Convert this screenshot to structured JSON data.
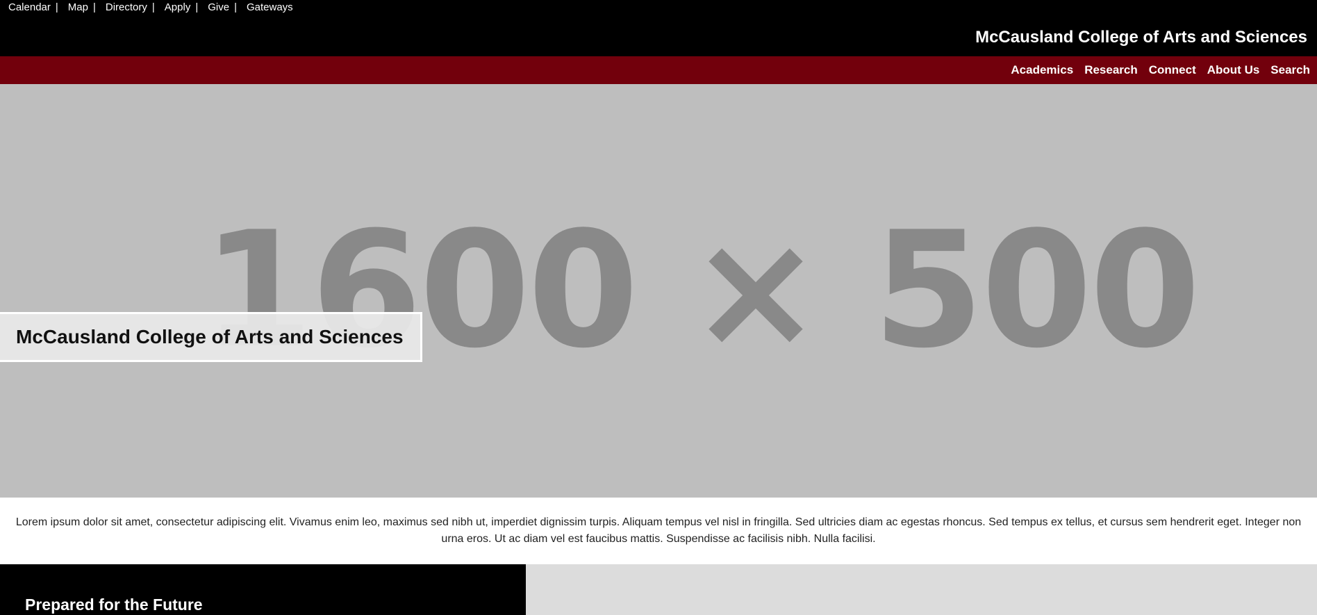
{
  "utility_nav": {
    "items": [
      {
        "label": "Calendar",
        "sep": "|"
      },
      {
        "label": "Map",
        "sep": "|"
      },
      {
        "label": "Directory",
        "sep": "|"
      },
      {
        "label": "Apply",
        "sep": "|"
      },
      {
        "label": "Give",
        "sep": "|"
      },
      {
        "label": "Gateways"
      }
    ]
  },
  "header": {
    "site_title": "McCausland College of Arts and Sciences"
  },
  "main_nav": {
    "items": [
      {
        "label": "Academics"
      },
      {
        "label": "Research"
      },
      {
        "label": "Connect"
      },
      {
        "label": "About Us"
      },
      {
        "label": "Search"
      }
    ]
  },
  "hero": {
    "placeholder_text": "1600 × 500",
    "caption": "McCausland College of Arts and Sciences"
  },
  "intro": {
    "text": "Lorem ipsum dolor sit amet, consectetur adipiscing elit. Vivamus enim leo, maximus sed nibh ut, imperdiet dignissim turpis. Aliquam tempus vel nisl in fringilla. Sed ultricies diam ac egestas rhoncus. Sed tempus ex tellus, et cursus sem hendrerit eget. Integer non urna eros. Ut ac diam vel est faucibus mattis. Suspendisse ac facilisis nibh. Nulla facilisi."
  },
  "feature": {
    "heading": "Prepared for the Future"
  },
  "colors": {
    "header_bg": "#000000",
    "nav_bg": "#72000c",
    "hero_bg": "#bebebe",
    "feature_dark": "#000000",
    "feature_light": "#dcdcdc"
  }
}
